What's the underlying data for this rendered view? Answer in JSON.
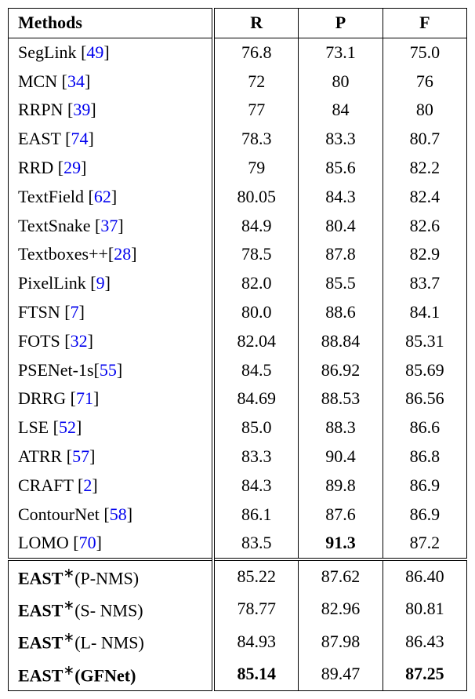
{
  "chart_data": {
    "type": "table",
    "headers": {
      "methods": "Methods",
      "r": "R",
      "p": "P",
      "f": "F"
    },
    "rows": [
      {
        "name": "SegLink",
        "cite": "49",
        "r": "76.8",
        "p": "73.1",
        "f": "75.0"
      },
      {
        "name": "MCN",
        "cite": "34",
        "r": "72",
        "p": "80",
        "f": "76"
      },
      {
        "name": "RRPN",
        "cite": "39",
        "r": "77",
        "p": "84",
        "f": "80"
      },
      {
        "name": "EAST",
        "cite": "74",
        "r": "78.3",
        "p": "83.3",
        "f": "80.7"
      },
      {
        "name": "RRD",
        "cite": "29",
        "r": "79",
        "p": "85.6",
        "f": "82.2"
      },
      {
        "name": "TextField",
        "cite": "62",
        "r": "80.05",
        "p": "84.3",
        "f": "82.4"
      },
      {
        "name": "TextSnake",
        "cite": "37",
        "r": "84.9",
        "p": "80.4",
        "f": "82.6"
      },
      {
        "name": "Textboxes++",
        "cite": "28",
        "nospace": true,
        "r": "78.5",
        "p": "87.8",
        "f": "82.9"
      },
      {
        "name": "PixelLink",
        "cite": "9",
        "r": "82.0",
        "p": "85.5",
        "f": "83.7"
      },
      {
        "name": "FTSN",
        "cite": "7",
        "r": "80.0",
        "p": "88.6",
        "f": "84.1"
      },
      {
        "name": "FOTS",
        "cite": "32",
        "r": "82.04",
        "p": "88.84",
        "f": "85.31"
      },
      {
        "name": "PSENet-1s",
        "cite": "55",
        "nospace": true,
        "r": "84.5",
        "p": "86.92",
        "f": "85.69"
      },
      {
        "name": "DRRG",
        "cite": "71",
        "r": "84.69",
        "p": "88.53",
        "f": "86.56"
      },
      {
        "name": "LSE",
        "cite": "52",
        "r": "85.0",
        "p": "88.3",
        "f": "86.6"
      },
      {
        "name": "ATRR",
        "cite": "57",
        "r": "83.3",
        "p": "90.4",
        "f": "86.8"
      },
      {
        "name": "CRAFT",
        "cite": "2",
        "r": "84.3",
        "p": "89.8",
        "f": "86.9"
      },
      {
        "name": "ContourNet",
        "cite": "58",
        "r": "86.1",
        "p": "87.6",
        "f": "86.9"
      },
      {
        "name": "LOMO",
        "cite": "70",
        "r": "83.5",
        "p": "91.3",
        "p_bold": true,
        "f": "87.2"
      }
    ],
    "east_rows": [
      {
        "name_prefix": "EAST",
        "suffix": "(P-NMS)",
        "r": "85.22",
        "p": "87.62",
        "f": "86.40"
      },
      {
        "name_prefix": "EAST",
        "suffix": "(S- NMS)",
        "r": "78.77",
        "p": "82.96",
        "f": "80.81"
      },
      {
        "name_prefix": "EAST",
        "suffix": "(L- NMS)",
        "r": "84.93",
        "p": "87.98",
        "f": "86.43"
      },
      {
        "name_prefix": "EAST",
        "suffix": "(GFNet)",
        "bold_suffix": true,
        "r": "85.14",
        "r_bold": true,
        "p": "89.47",
        "f": "87.25",
        "f_bold": true
      }
    ]
  }
}
